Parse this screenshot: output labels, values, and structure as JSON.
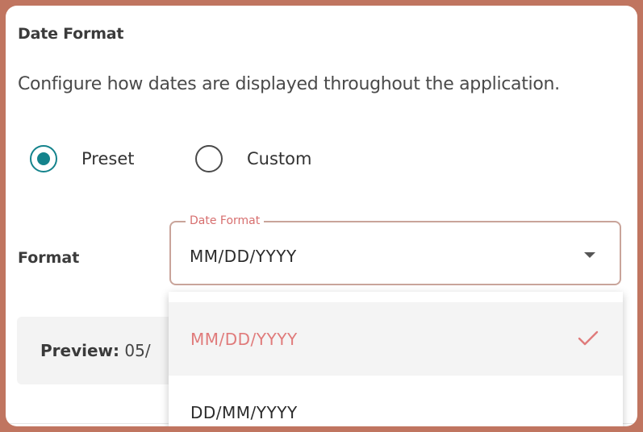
{
  "section": {
    "title": "Date Format",
    "description": "Configure how dates are displayed throughout the application."
  },
  "mode": {
    "options": [
      {
        "label": "Preset",
        "checked": true
      },
      {
        "label": "Custom",
        "checked": false
      }
    ]
  },
  "format": {
    "label": "Format",
    "select_legend": "Date Format",
    "selected_value": "MM/DD/YYYY"
  },
  "preview": {
    "label": "Preview:",
    "value": "05/"
  },
  "dropdown": {
    "options": [
      {
        "label": "MM/DD/YYYY",
        "selected": true
      },
      {
        "label": "DD/MM/YYYY",
        "selected": false
      }
    ]
  },
  "colors": {
    "accent_teal": "#14838c",
    "accent_coral": "#e07b7b",
    "frame": "#c07560"
  },
  "icons": {
    "caret": "caret-down-icon",
    "check": "checkmark-icon"
  }
}
